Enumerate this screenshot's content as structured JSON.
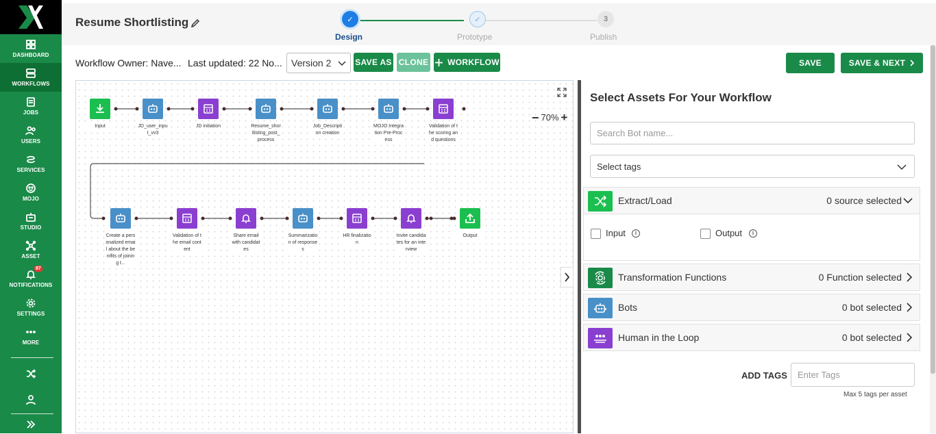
{
  "colors": {
    "brand": "#1a8a48",
    "brand_dark": "#0e6f34",
    "bot": "#4a90c8",
    "purple": "#8a3fd1",
    "trigger": "#1bbf50",
    "clone": "#6cc29a"
  },
  "sidebar": {
    "items": [
      {
        "label": "DASHBOARD",
        "icon": "dashboard-icon"
      },
      {
        "label": "WORKFLOWS",
        "icon": "workflows-icon"
      },
      {
        "label": "JOBS",
        "icon": "jobs-icon"
      },
      {
        "label": "USERS",
        "icon": "users-icon"
      },
      {
        "label": "SERVICES",
        "icon": "services-icon"
      },
      {
        "label": "MOJO",
        "icon": "mojo-icon"
      },
      {
        "label": "STUDIO",
        "icon": "studio-icon"
      },
      {
        "label": "ASSET",
        "icon": "asset-icon"
      },
      {
        "label": "NOTIFICATIONS",
        "icon": "bell-icon",
        "badge": "87"
      },
      {
        "label": "SETTINGS",
        "icon": "gear-icon"
      },
      {
        "label": "MORE",
        "icon": "more-icon"
      }
    ]
  },
  "header": {
    "title": "Resume Shortlisting",
    "steps": [
      {
        "label": "Design",
        "num": "✓"
      },
      {
        "label": "Prototype",
        "num": "✓"
      },
      {
        "label": "Publish",
        "num": "3"
      }
    ]
  },
  "toolbar": {
    "owner": "Workflow Owner: Nave...",
    "updated": "Last updated: 22 No...",
    "version": "Version 2",
    "save_as": "SAVE AS",
    "clone": "CLONE",
    "workflow": "WORKFLOW",
    "save": "SAVE",
    "save_next": "SAVE & NEXT"
  },
  "canvas": {
    "zoom": "70%",
    "row1": [
      {
        "type": "input",
        "label": "Input"
      },
      {
        "type": "bot",
        "label": "JD_user_input_vv3"
      },
      {
        "type": "purple",
        "label": "JD initiation"
      },
      {
        "type": "bot",
        "label": "Resume_shortlisting_post_process"
      },
      {
        "type": "bot",
        "label": "Job_Description creation"
      },
      {
        "type": "bot",
        "label": "MOJO Integration Pre-Process"
      },
      {
        "type": "purple",
        "label": "Validation of the scoring and questions"
      }
    ],
    "row2": [
      {
        "type": "bot",
        "label": "Create a personalized email about the benifits of joining t..."
      },
      {
        "type": "purple",
        "label": "Validation of the email content"
      },
      {
        "type": "bell",
        "label": "Share email with candidates"
      },
      {
        "type": "bot",
        "label": "Summarization of responses"
      },
      {
        "type": "purple",
        "label": "HR finalization"
      },
      {
        "type": "bell",
        "label": "Invite candidates for an interview"
      },
      {
        "type": "output",
        "label": "Output"
      }
    ]
  },
  "panel": {
    "title": "Select Assets For Your Workflow",
    "search_placeholder": "Search Bot name...",
    "tags_placeholder": "Select tags",
    "sections": [
      {
        "title": "Extract/Load",
        "count": "0 source selected",
        "icon": "shuffle-icon",
        "color": "#1bbf50"
      },
      {
        "title": "Transformation Functions",
        "count": "0 Function selected",
        "icon": "transform-icon",
        "color": "#1a8a48"
      },
      {
        "title": "Bots",
        "count": "0 bot selected",
        "icon": "bot-icon",
        "color": "#4a90c8"
      },
      {
        "title": "Human in the Loop",
        "count": "0 bot selected",
        "icon": "people-icon",
        "color": "#8a3fd1"
      }
    ],
    "input_label": "Input",
    "output_label": "Output",
    "add_tags": "ADD TAGS",
    "tags_input_placeholder": "Enter Tags",
    "tags_hint": "Max 5 tags per asset"
  }
}
